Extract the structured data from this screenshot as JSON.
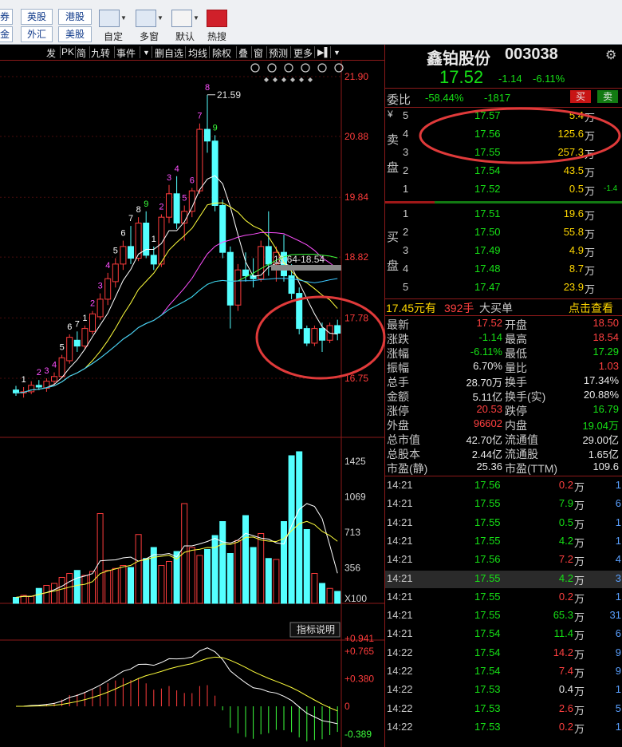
{
  "toolbar": {
    "market_buttons": [
      "券",
      "英股",
      "港股",
      "金",
      "外汇",
      "美股"
    ],
    "tools": [
      {
        "label": "自定",
        "icon": "custom-layout-icon"
      },
      {
        "label": "多窗",
        "icon": "multi-window-icon"
      },
      {
        "label": "默认",
        "icon": "home-icon"
      },
      {
        "label": "热搜",
        "icon": "hot-search-icon"
      }
    ]
  },
  "chart_toolbar": {
    "items": [
      "发",
      "PK",
      "简",
      "九转",
      "事件",
      "删自选",
      "均线",
      "除权",
      "叠",
      "窗",
      "预测",
      "更多"
    ]
  },
  "kline": {
    "price_ticks": [
      "21.90",
      "20.88",
      "19.84",
      "18.82",
      "17.78",
      "16.75"
    ],
    "high_label": "21.59",
    "range_label": "18.64-18.54",
    "nine_turn_labels": [
      "1",
      "2",
      "3",
      "4",
      "5",
      "6",
      "7",
      "1",
      "2",
      "3",
      "4",
      "5",
      "6",
      "7",
      "8",
      "9",
      "1",
      "2",
      "3",
      "4",
      "5",
      "6",
      "7",
      "8",
      "9"
    ],
    "candles": [
      [
        16.55,
        16.62,
        16.45,
        16.5
      ],
      [
        16.5,
        16.6,
        16.42,
        16.52
      ],
      [
        16.52,
        16.7,
        16.48,
        16.63
      ],
      [
        16.63,
        16.72,
        16.55,
        16.6
      ],
      [
        16.58,
        16.75,
        16.52,
        16.7
      ],
      [
        16.7,
        16.85,
        16.62,
        16.78
      ],
      [
        16.78,
        17.15,
        16.75,
        17.1
      ],
      [
        17.05,
        17.5,
        17.0,
        17.45
      ],
      [
        17.4,
        17.55,
        17.2,
        17.3
      ],
      [
        17.3,
        17.65,
        17.25,
        17.6
      ],
      [
        17.55,
        17.9,
        17.5,
        17.85
      ],
      [
        17.8,
        18.2,
        17.75,
        18.1
      ],
      [
        18.1,
        18.55,
        18.0,
        18.45
      ],
      [
        18.4,
        18.8,
        18.3,
        18.7
      ],
      [
        18.7,
        19.1,
        18.6,
        19.0
      ],
      [
        19.0,
        19.35,
        18.7,
        18.8
      ],
      [
        18.8,
        19.5,
        18.75,
        19.4
      ],
      [
        19.4,
        19.6,
        18.8,
        18.85
      ],
      [
        18.85,
        19.0,
        18.6,
        18.7
      ],
      [
        18.7,
        19.55,
        18.65,
        19.5
      ],
      [
        19.5,
        20.05,
        19.4,
        19.9
      ],
      [
        19.9,
        20.2,
        19.3,
        19.4
      ],
      [
        19.4,
        19.7,
        19.1,
        19.6
      ],
      [
        19.6,
        20.0,
        19.5,
        19.95
      ],
      [
        19.95,
        21.1,
        19.9,
        21.0
      ],
      [
        21.0,
        21.59,
        20.6,
        20.8
      ],
      [
        20.8,
        20.9,
        19.6,
        19.7
      ],
      [
        19.7,
        19.8,
        18.8,
        18.9
      ],
      [
        18.9,
        19.0,
        17.6,
        18.0
      ],
      [
        18.0,
        18.7,
        17.9,
        18.6
      ],
      [
        18.6,
        18.9,
        18.4,
        18.5
      ],
      [
        18.5,
        18.8,
        18.3,
        18.45
      ],
      [
        18.45,
        19.1,
        18.4,
        19.0
      ],
      [
        19.0,
        19.6,
        18.5,
        18.7
      ],
      [
        18.7,
        19.0,
        18.4,
        18.9
      ],
      [
        18.9,
        19.2,
        18.4,
        18.5
      ],
      [
        18.5,
        18.7,
        18.1,
        18.2
      ],
      [
        18.2,
        18.3,
        17.5,
        17.6
      ],
      [
        17.6,
        17.65,
        17.3,
        17.35
      ],
      [
        17.35,
        17.65,
        17.3,
        17.6
      ],
      [
        17.6,
        17.7,
        17.2,
        17.4
      ],
      [
        17.4,
        17.7,
        17.35,
        17.65
      ],
      [
        17.65,
        17.75,
        17.4,
        17.52
      ]
    ]
  },
  "volume": {
    "ticks": [
      "1425",
      "1069",
      "713",
      "356",
      "X100"
    ],
    "values": [
      60,
      80,
      70,
      150,
      180,
      200,
      260,
      300,
      330,
      280,
      320,
      900,
      330,
      350,
      380,
      360,
      690,
      450,
      560,
      380,
      420,
      520,
      1000,
      560,
      480,
      540,
      680,
      820,
      500,
      630,
      880,
      560,
      700,
      450,
      440,
      820,
      1480,
      1520,
      740,
      300,
      200,
      150,
      120
    ]
  },
  "macd": {
    "button": "指标说明",
    "ticks": [
      "+0.941",
      "+0.765",
      "+0.380",
      "0",
      "-0.389"
    ]
  },
  "stock": {
    "name": "鑫铂股份",
    "code": "003038",
    "price": "17.52",
    "change": "-1.14",
    "change_pct": "-6.11%"
  },
  "committee": {
    "label": "委比",
    "ratio": "-58.44%",
    "diff": "-1817",
    "buy_btn": "买",
    "sell_btn": "卖"
  },
  "sell_side": {
    "label_chars": [
      "卖",
      "盘"
    ],
    "yen_sign": "¥",
    "levels": [
      {
        "n": "5",
        "price": "17.57",
        "vol": "5.4",
        "unit": "万",
        "extra": ""
      },
      {
        "n": "4",
        "price": "17.56",
        "vol": "125.6",
        "unit": "万",
        "extra": ""
      },
      {
        "n": "3",
        "price": "17.55",
        "vol": "257.3",
        "unit": "万",
        "extra": ""
      },
      {
        "n": "2",
        "price": "17.54",
        "vol": "43.5",
        "unit": "万",
        "extra": ""
      },
      {
        "n": "1",
        "price": "17.52",
        "vol": "0.5",
        "unit": "万",
        "extra": "-1.4"
      }
    ]
  },
  "buy_side": {
    "label_chars": [
      "买",
      "盘"
    ],
    "levels": [
      {
        "n": "1",
        "price": "17.51",
        "vol": "19.6",
        "unit": "万"
      },
      {
        "n": "2",
        "price": "17.50",
        "vol": "55.8",
        "unit": "万"
      },
      {
        "n": "3",
        "price": "17.49",
        "vol": "4.9",
        "unit": "万"
      },
      {
        "n": "4",
        "price": "17.48",
        "vol": "8.7",
        "unit": "万"
      },
      {
        "n": "5",
        "price": "17.47",
        "vol": "23.9",
        "unit": "万"
      }
    ]
  },
  "big_order": {
    "price": "17.45元有",
    "hands": "392手",
    "label": "大买单",
    "link": "点击查看"
  },
  "stats": [
    {
      "l1": "最新",
      "v1": "17.52",
      "c1": "red",
      "l2": "开盘",
      "v2": "18.50",
      "c2": "red"
    },
    {
      "l1": "涨跌",
      "v1": "-1.14",
      "c1": "green",
      "l2": "最高",
      "v2": "18.54",
      "c2": "red"
    },
    {
      "l1": "涨幅",
      "v1": "-6.11%",
      "c1": "green",
      "l2": "最低",
      "v2": "17.29",
      "c2": "green"
    },
    {
      "l1": "振幅",
      "v1": "6.70%",
      "c1": "white",
      "l2": "量比",
      "v2": "1.03",
      "c2": "red"
    },
    {
      "l1": "总手",
      "v1": "28.70万",
      "c1": "white",
      "l2": "换手",
      "v2": "17.34%",
      "c2": "white"
    },
    {
      "l1": "金额",
      "v1": "5.11亿",
      "c1": "white",
      "l2": "换手(实)",
      "v2": "20.88%",
      "c2": "white"
    },
    {
      "l1": "涨停",
      "v1": "20.53",
      "c1": "red",
      "l2": "跌停",
      "v2": "16.79",
      "c2": "green"
    },
    {
      "l1": "外盘",
      "v1": "96602",
      "c1": "red",
      "l2": "内盘",
      "v2": "19.04万",
      "c2": "green"
    },
    {
      "l1": "总市值",
      "v1": "42.70亿",
      "c1": "white",
      "l2": "流通值",
      "v2": "29.00亿",
      "c2": "white"
    },
    {
      "l1": "总股本",
      "v1": "2.44亿",
      "c1": "white",
      "l2": "流通股",
      "v2": "1.65亿",
      "c2": "white"
    },
    {
      "l1": "市盈(静)",
      "v1": "25.36",
      "c1": "white",
      "l2": "市盈(TTM)",
      "v2": "109.6",
      "c2": "white"
    }
  ],
  "ticks_list": [
    {
      "time": "14:21",
      "price": "17.56",
      "vol": "0.2",
      "unit": "万",
      "n": "1",
      "vc": "red"
    },
    {
      "time": "14:21",
      "price": "17.55",
      "vol": "7.9",
      "unit": "万",
      "n": "6",
      "vc": "green"
    },
    {
      "time": "14:21",
      "price": "17.55",
      "vol": "0.5",
      "unit": "万",
      "n": "1",
      "vc": "green"
    },
    {
      "time": "14:21",
      "price": "17.55",
      "vol": "4.2",
      "unit": "万",
      "n": "1",
      "vc": "green"
    },
    {
      "time": "14:21",
      "price": "17.56",
      "vol": "7.2",
      "unit": "万",
      "n": "4",
      "vc": "red"
    },
    {
      "time": "14:21",
      "price": "17.55",
      "vol": "4.2",
      "unit": "万",
      "n": "3",
      "vc": "green"
    },
    {
      "time": "14:21",
      "price": "17.55",
      "vol": "0.2",
      "unit": "万",
      "n": "1",
      "vc": "red"
    },
    {
      "time": "14:21",
      "price": "17.55",
      "vol": "65.3",
      "unit": "万",
      "n": "31",
      "vc": "green"
    },
    {
      "time": "14:21",
      "price": "17.54",
      "vol": "11.4",
      "unit": "万",
      "n": "6",
      "vc": "green"
    },
    {
      "time": "14:22",
      "price": "17.54",
      "vol": "14.2",
      "unit": "万",
      "n": "9",
      "vc": "red"
    },
    {
      "time": "14:22",
      "price": "17.54",
      "vol": "7.4",
      "unit": "万",
      "n": "9",
      "vc": "red"
    },
    {
      "time": "14:22",
      "price": "17.53",
      "vol": "0.4",
      "unit": "万",
      "n": "1",
      "vc": "white"
    },
    {
      "time": "14:22",
      "price": "17.53",
      "vol": "2.6",
      "unit": "万",
      "n": "5",
      "vc": "red"
    },
    {
      "time": "14:22",
      "price": "17.53",
      "vol": "0.2",
      "unit": "万",
      "n": "1",
      "vc": "red"
    }
  ],
  "colors": {
    "up": "#ff3c3c",
    "down": "#54ffff",
    "grid": "#8b1a1a",
    "annotation_circle": "#e03a3a",
    "ma5": "#ffffff",
    "ma10": "#ffff3c",
    "ma20": "#ff50ff",
    "ma30": "#3cff3c",
    "ma60": "#3cc8ff"
  }
}
